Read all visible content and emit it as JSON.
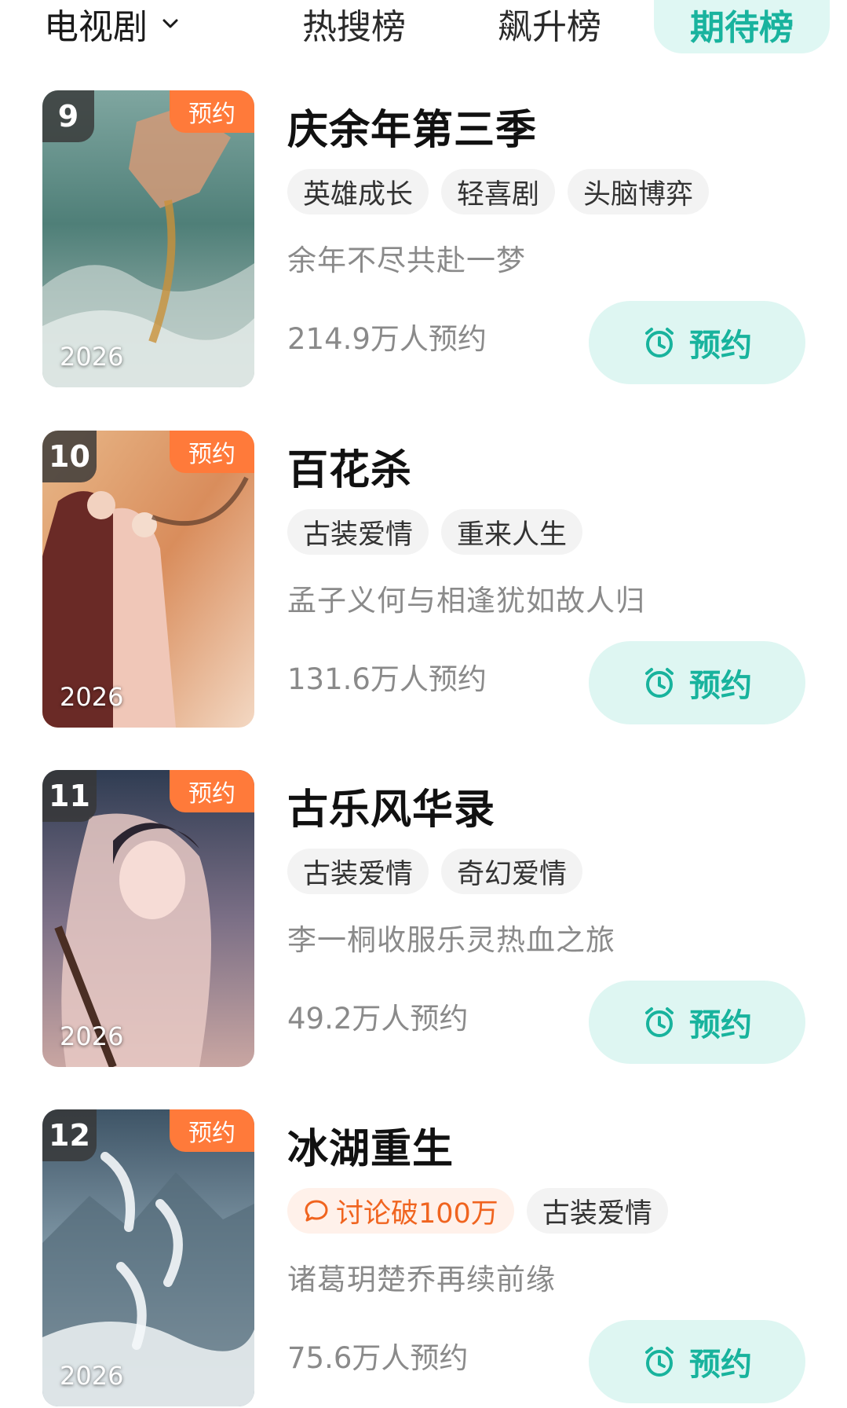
{
  "tabs": {
    "category": "电视剧",
    "items": [
      {
        "label": "热搜榜"
      },
      {
        "label": "飙升榜"
      },
      {
        "label": "期待榜"
      }
    ]
  },
  "accent_color": "#19b39e",
  "badge_color": "#ff7a3a",
  "shows": [
    {
      "rank": "9",
      "badge": "预约",
      "year": "2026",
      "title": "庆余年第三季",
      "tags": [
        "英雄成长",
        "轻喜剧",
        "头脑博弈"
      ],
      "desc": "余年不尽共赴一梦",
      "count": "214.9万人预约",
      "button": "预约"
    },
    {
      "rank": "10",
      "badge": "预约",
      "year": "2026",
      "title": "百花杀",
      "tags": [
        "古装爱情",
        "重来人生"
      ],
      "desc": "孟子义何与相逢犹如故人归",
      "count": "131.6万人预约",
      "button": "预约"
    },
    {
      "rank": "11",
      "badge": "预约",
      "year": "2026",
      "title": "古乐风华录",
      "tags": [
        "古装爱情",
        "奇幻爱情"
      ],
      "desc": "李一桐收服乐灵热血之旅",
      "count": "49.2万人预约",
      "button": "预约"
    },
    {
      "rank": "12",
      "badge": "预约",
      "year": "2026",
      "title": "冰湖重生",
      "hot_tag": "讨论破100万",
      "tags": [
        "古装爱情"
      ],
      "desc": "诸葛玥楚乔再续前缘",
      "count": "75.6万人预约",
      "button": "预约"
    }
  ]
}
